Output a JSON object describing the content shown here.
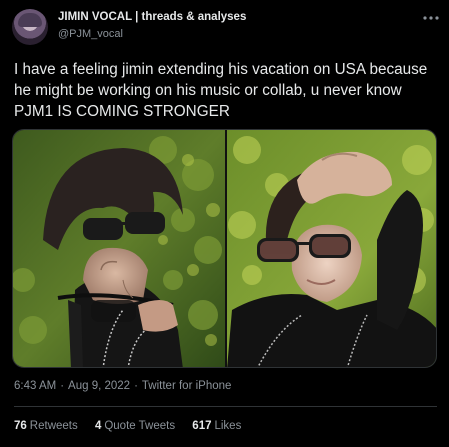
{
  "author": {
    "display_name": "JIMIN VOCAL | threads & analyses",
    "handle": "@PJM_vocal"
  },
  "more_icon": "ellipsis-icon",
  "tweet": {
    "text": "I have a feeling jimin extending his vacation on USA because he might be working on his music or collab, u never know PJM1 IS COMING STRONGER"
  },
  "media": {
    "photos": [
      "photo-left",
      "photo-right"
    ]
  },
  "meta": {
    "time": "6:43 AM",
    "sep1": "·",
    "date": "Aug 9, 2022",
    "sep2": "·",
    "source": "Twitter for iPhone"
  },
  "stats": {
    "retweets_count": "76",
    "retweets_label": "Retweets",
    "quotes_count": "4",
    "quotes_label": "Quote Tweets",
    "likes_count": "617",
    "likes_label": "Likes"
  },
  "colors": {
    "background": "#000000",
    "text": "#e7e9ea",
    "secondary": "#8b9299",
    "border": "#2f3336"
  }
}
